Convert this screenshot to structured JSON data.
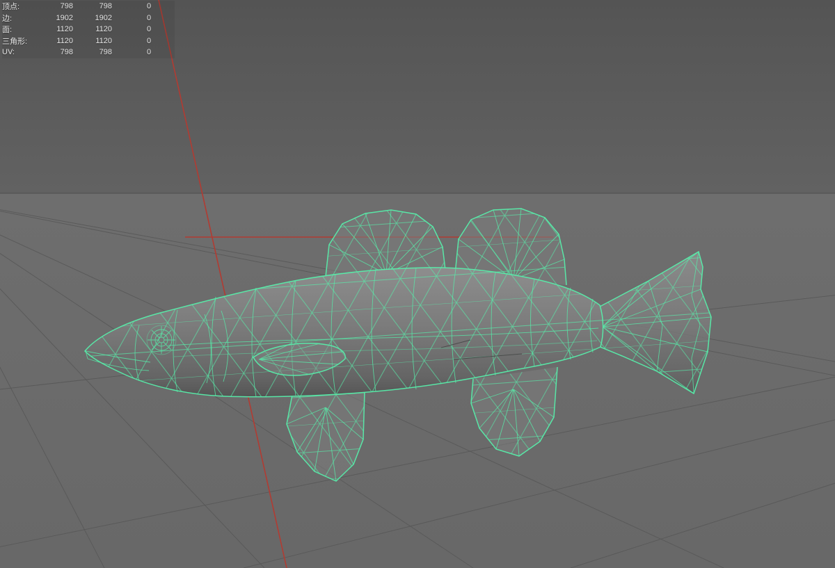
{
  "stats_hud": {
    "rows": [
      {
        "id": "vertices",
        "label": "顶点:",
        "total": "798",
        "selected": "798",
        "other": "0"
      },
      {
        "id": "edges",
        "label": "边:",
        "total": "1902",
        "selected": "1902",
        "other": "0"
      },
      {
        "id": "faces",
        "label": "面:",
        "total": "1120",
        "selected": "1120",
        "other": "0"
      },
      {
        "id": "triangles",
        "label": "三角形:",
        "total": "1120",
        "selected": "1120",
        "other": "0"
      },
      {
        "id": "uv",
        "label": "UV:",
        "total": "798",
        "selected": "798",
        "other": "0"
      }
    ]
  },
  "colors": {
    "wireframe": "#57EDAA",
    "axis_red": "#B23B32",
    "sky": "#575757",
    "ground": "#6C6C6C",
    "grid_line": "#585858",
    "hud_text": "#E4E4E4"
  }
}
